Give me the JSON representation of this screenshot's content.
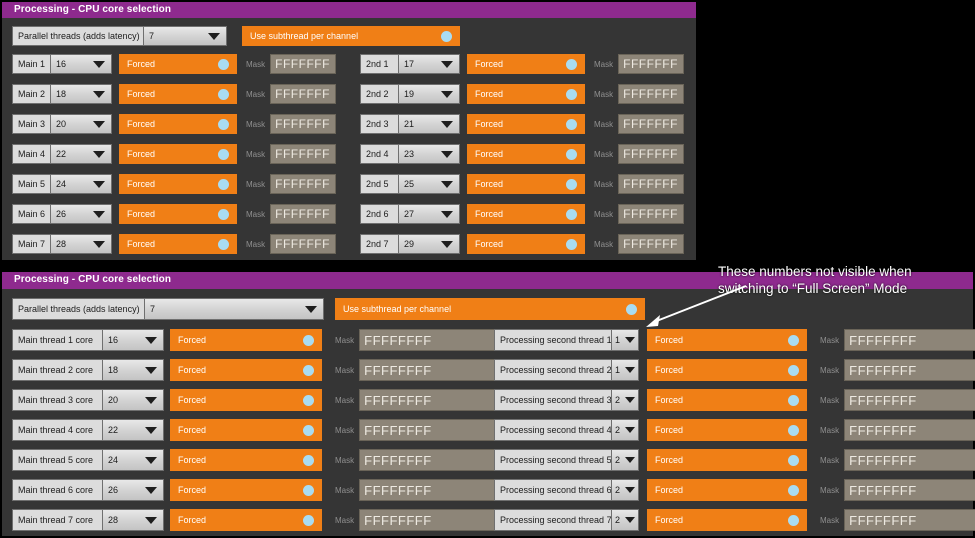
{
  "colors": {
    "title_purple": "#8e2a8e",
    "panel_bg": "#353535",
    "accent_orange": "#f07f16",
    "led_blue": "#a9dcf2",
    "mask_bg": "#8d8578",
    "combo_bg": "#d6d6d6",
    "page_bg": "#000000"
  },
  "annotation": {
    "text": "These numbers not visible when\nswitching to “Full Screen” Mode"
  },
  "top_panel": {
    "title": "Processing - CPU core selection",
    "parallel": {
      "label": "Parallel threads (adds latency)",
      "value": "7"
    },
    "subthread": {
      "label": "Use subthread per channel",
      "state": "on"
    },
    "mask_label": "Mask",
    "forced_label": "Forced",
    "main_rows": [
      {
        "label": "Main 1",
        "core": "16",
        "forced": "Forced",
        "mask": "FFFFFFF"
      },
      {
        "label": "Main 2",
        "core": "18",
        "forced": "Forced",
        "mask": "FFFFFFF"
      },
      {
        "label": "Main 3",
        "core": "20",
        "forced": "Forced",
        "mask": "FFFFFFF"
      },
      {
        "label": "Main 4",
        "core": "22",
        "forced": "Forced",
        "mask": "FFFFFFF"
      },
      {
        "label": "Main 5",
        "core": "24",
        "forced": "Forced",
        "mask": "FFFFFFF"
      },
      {
        "label": "Main 6",
        "core": "26",
        "forced": "Forced",
        "mask": "FFFFFFF"
      },
      {
        "label": "Main 7",
        "core": "28",
        "forced": "Forced",
        "mask": "FFFFFFF"
      }
    ],
    "second_rows": [
      {
        "label": "2nd 1",
        "core": "17",
        "forced": "Forced",
        "mask": "FFFFFFF"
      },
      {
        "label": "2nd 2",
        "core": "19",
        "forced": "Forced",
        "mask": "FFFFFFF"
      },
      {
        "label": "2nd 3",
        "core": "21",
        "forced": "Forced",
        "mask": "FFFFFFF"
      },
      {
        "label": "2nd 4",
        "core": "23",
        "forced": "Forced",
        "mask": "FFFFFFF"
      },
      {
        "label": "2nd 5",
        "core": "25",
        "forced": "Forced",
        "mask": "FFFFFFF"
      },
      {
        "label": "2nd 6",
        "core": "27",
        "forced": "Forced",
        "mask": "FFFFFFF"
      },
      {
        "label": "2nd 7",
        "core": "29",
        "forced": "Forced",
        "mask": "FFFFFFF"
      }
    ]
  },
  "bottom_panel": {
    "title": "Processing - CPU core selection",
    "parallel": {
      "label": "Parallel threads (adds latency)",
      "value": "7"
    },
    "subthread": {
      "label": "Use subthread per channel",
      "state": "on"
    },
    "mask_label": "Mask",
    "forced_label": "Forced",
    "main_rows": [
      {
        "label": "Main thread 1 core",
        "core": "16",
        "forced": "Forced",
        "mask": "FFFFFFFF"
      },
      {
        "label": "Main thread 2 core",
        "core": "18",
        "forced": "Forced",
        "mask": "FFFFFFFF"
      },
      {
        "label": "Main thread 3 core",
        "core": "20",
        "forced": "Forced",
        "mask": "FFFFFFFF"
      },
      {
        "label": "Main thread 4 core",
        "core": "22",
        "forced": "Forced",
        "mask": "FFFFFFFF"
      },
      {
        "label": "Main thread 5 core",
        "core": "24",
        "forced": "Forced",
        "mask": "FFFFFFFF"
      },
      {
        "label": "Main thread 6 core",
        "core": "26",
        "forced": "Forced",
        "mask": "FFFFFFFF"
      },
      {
        "label": "Main thread 7 core",
        "core": "28",
        "forced": "Forced",
        "mask": "FFFFFFFF"
      }
    ],
    "second_rows": [
      {
        "label": "Processing second thread 1",
        "core": "1",
        "forced": "Forced",
        "mask": "FFFFFFFF"
      },
      {
        "label": "Processing second thread 2",
        "core": "1",
        "forced": "Forced",
        "mask": "FFFFFFFF"
      },
      {
        "label": "Processing second thread 3",
        "core": "2",
        "forced": "Forced",
        "mask": "FFFFFFFF"
      },
      {
        "label": "Processing second thread 4",
        "core": "2",
        "forced": "Forced",
        "mask": "FFFFFFFF"
      },
      {
        "label": "Processing second thread 5",
        "core": "2",
        "forced": "Forced",
        "mask": "FFFFFFFF"
      },
      {
        "label": "Processing second thread 6",
        "core": "2",
        "forced": "Forced",
        "mask": "FFFFFFFF"
      },
      {
        "label": "Processing second thread 7",
        "core": "2",
        "forced": "Forced",
        "mask": "FFFFFFFF"
      }
    ]
  }
}
